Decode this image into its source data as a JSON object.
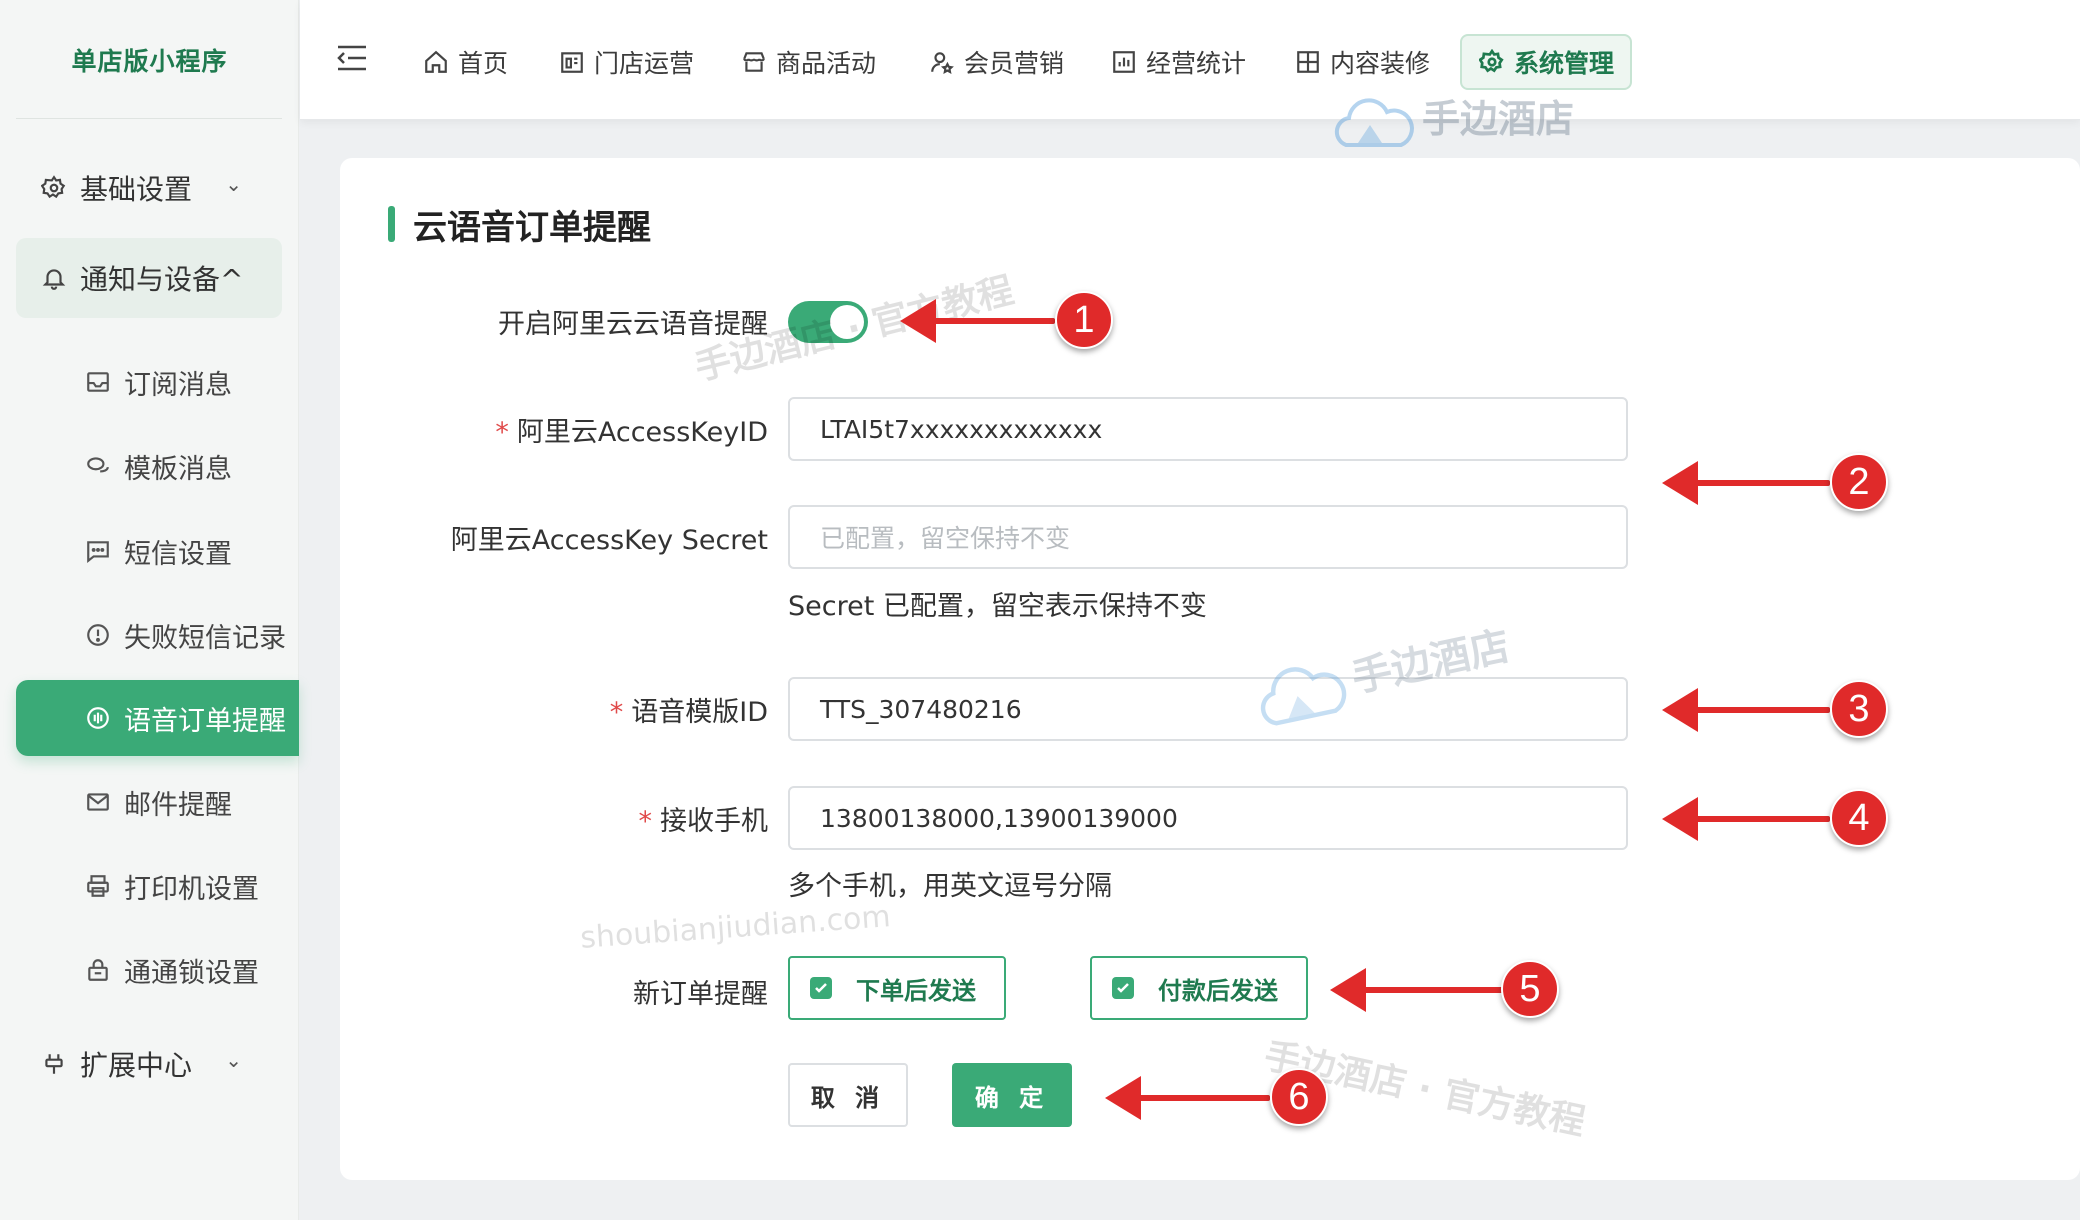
{
  "sidebar": {
    "brand": "单店版小程序",
    "groups": [
      {
        "label": "基础设置",
        "chevron": "⌄"
      },
      {
        "label": "通知与设备^"
      },
      {
        "label": "扩展中心",
        "chevron": "⌄"
      }
    ],
    "items": [
      {
        "label": "订阅消息",
        "icon": "inbox-icon"
      },
      {
        "label": "模板消息",
        "icon": "chat-icon"
      },
      {
        "label": "短信设置",
        "icon": "message-icon"
      },
      {
        "label": "失败短信记录",
        "icon": "alert-circle-icon"
      },
      {
        "label": "语音订单提醒",
        "icon": "voice-icon"
      },
      {
        "label": "邮件提醒",
        "icon": "mail-icon"
      },
      {
        "label": "打印机设置",
        "icon": "printer-icon"
      },
      {
        "label": "通通锁设置",
        "icon": "lock-icon"
      }
    ]
  },
  "topnav": {
    "items": [
      {
        "label": "首页",
        "icon": "home-icon"
      },
      {
        "label": "门店运营",
        "icon": "store-icon"
      },
      {
        "label": "商品活动",
        "icon": "shop-icon"
      },
      {
        "label": "会员营销",
        "icon": "user-star-icon"
      },
      {
        "label": "经营统计",
        "icon": "chart-icon"
      },
      {
        "label": "内容装修",
        "icon": "layout-icon"
      },
      {
        "label": "系统管理",
        "icon": "gear-icon"
      }
    ]
  },
  "form": {
    "title": "云语音订单提醒",
    "toggle_label": "开启阿里云云语音提醒",
    "toggle_on": true,
    "access_key_id_label": "阿里云AccessKeyID",
    "access_key_id_value": "LTAI5t7xxxxxxxxxxxxx",
    "secret_label": "阿里云AccessKey Secret",
    "secret_placeholder": "已配置，留空保持不变",
    "secret_hint": "Secret 已配置，留空表示保持不变",
    "template_label": "语音模版ID",
    "template_value": "TTS_307480216",
    "phone_label": "接收手机",
    "phone_value": "13800138000,13900139000",
    "phone_hint": "多个手机，用英文逗号分隔",
    "new_order_label": "新订单提醒",
    "checkbox_1": "下单后发送",
    "checkbox_2": "付款后发送",
    "cancel": "取 消",
    "ok": "确 定",
    "required_mark": "*"
  },
  "annotations": [
    "1",
    "2",
    "3",
    "4",
    "5",
    "6"
  ],
  "watermarks": {
    "logo_text": "手边酒店",
    "tutorial_1": "手边酒店 · 官方教程",
    "url": "shoubianjiudian.com",
    "tutorial_2": "手边酒店 · 官方教程"
  },
  "colors": {
    "accent": "#3aaa77",
    "annotation": "#e02a2a"
  }
}
